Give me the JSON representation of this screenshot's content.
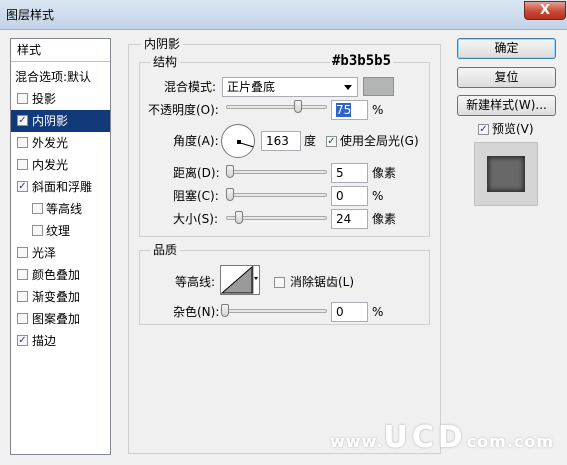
{
  "window": {
    "title": "图层样式",
    "close_label": "X"
  },
  "style_list": {
    "header": "样式",
    "blend_options": "混合选项:默认",
    "items": [
      {
        "label": "投影",
        "checked": false
      },
      {
        "label": "内阴影",
        "checked": true,
        "selected": true
      },
      {
        "label": "外发光",
        "checked": false
      },
      {
        "label": "内发光",
        "checked": false
      },
      {
        "label": "斜面和浮雕",
        "checked": true
      },
      {
        "label": "等高线",
        "checked": false,
        "indent": true
      },
      {
        "label": "纹理",
        "checked": false,
        "indent": true
      },
      {
        "label": "光泽",
        "checked": false
      },
      {
        "label": "颜色叠加",
        "checked": false
      },
      {
        "label": "渐变叠加",
        "checked": false
      },
      {
        "label": "图案叠加",
        "checked": false
      },
      {
        "label": "描边",
        "checked": true
      }
    ]
  },
  "inner_shadow": {
    "title": "内阴影",
    "structure": {
      "title": "结构",
      "color_annotation": "#b3b5b5",
      "blend_mode_label": "混合模式:",
      "blend_mode_value": "正片叠底",
      "shadow_color": "#b3b5b5",
      "opacity_label": "不透明度(O):",
      "opacity_value": "75",
      "opacity_unit": "%",
      "angle_label": "角度(A):",
      "angle_value": "163",
      "angle_unit": "度",
      "global_light_label": "使用全局光(G)",
      "global_light_checked": true,
      "distance_label": "距离(D):",
      "distance_value": "5",
      "distance_unit": "像素",
      "choke_label": "阻塞(C):",
      "choke_value": "0",
      "choke_unit": "%",
      "size_label": "大小(S):",
      "size_value": "24",
      "size_unit": "像素"
    },
    "quality": {
      "title": "品质",
      "contour_label": "等高线:",
      "anti_alias_label": "消除锯齿(L)",
      "anti_alias_checked": false,
      "noise_label": "杂色(N):",
      "noise_value": "0",
      "noise_unit": "%"
    }
  },
  "buttons": {
    "ok": "确定",
    "reset": "复位",
    "new_style": "新建样式(W)...",
    "preview_label": "预览(V)",
    "preview_checked": true
  },
  "watermark": {
    "prefix": "www.",
    "brand": "UCD",
    "suffix": "com.com"
  }
}
